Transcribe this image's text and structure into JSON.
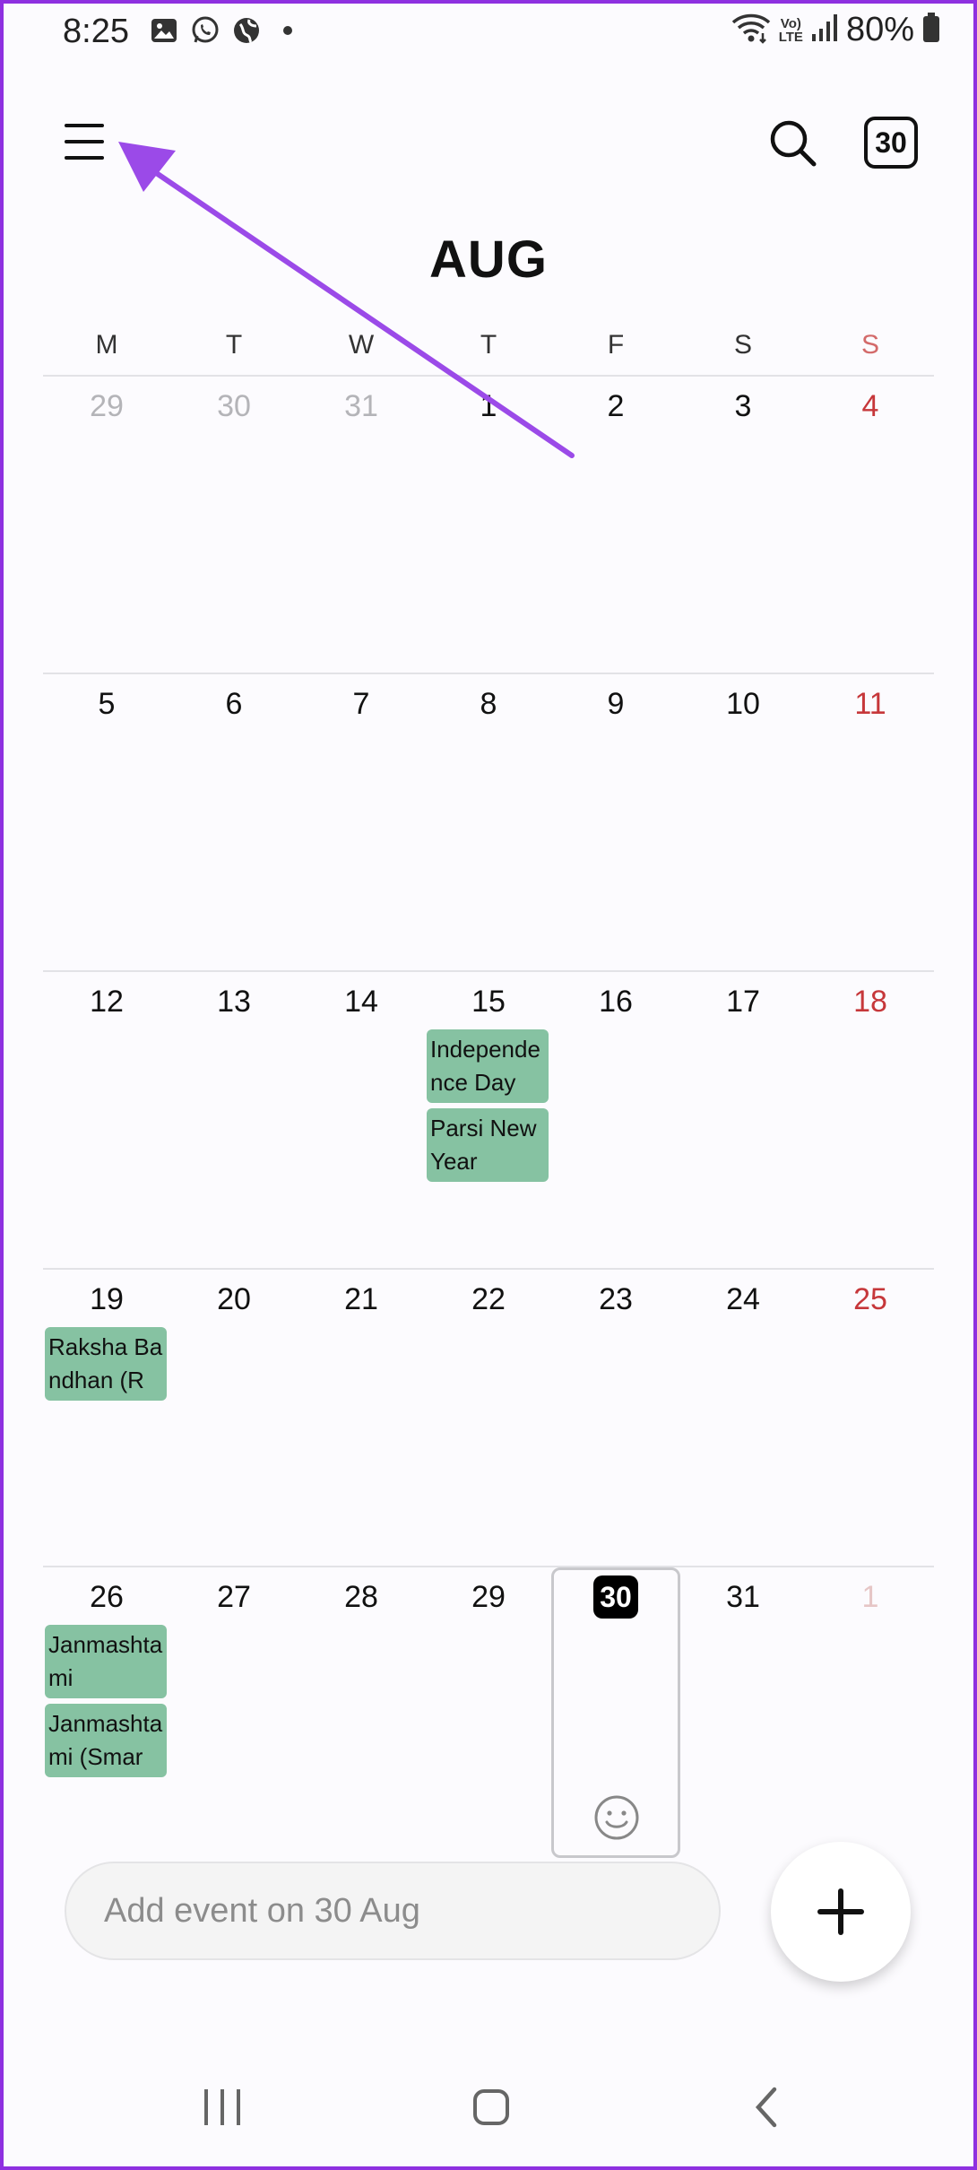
{
  "status_bar": {
    "time": "8:25",
    "battery": "80%",
    "volte_top": "Vo)",
    "volte_bottom": "LTE"
  },
  "header": {
    "month": "AUG",
    "today_button": "30"
  },
  "weekdays": [
    "M",
    "T",
    "W",
    "T",
    "F",
    "S",
    "S"
  ],
  "weeks": [
    {
      "days": [
        "29",
        "30",
        "31",
        "1",
        "2",
        "3",
        "4"
      ]
    },
    {
      "days": [
        "5",
        "6",
        "7",
        "8",
        "9",
        "10",
        "11"
      ]
    },
    {
      "days": [
        "12",
        "13",
        "14",
        "15",
        "16",
        "17",
        "18"
      ]
    },
    {
      "days": [
        "19",
        "20",
        "21",
        "22",
        "23",
        "24",
        "25"
      ]
    },
    {
      "days": [
        "26",
        "27",
        "28",
        "29",
        "30",
        "31",
        "1"
      ]
    }
  ],
  "events": {
    "independence_day": "Independence Day",
    "parsi_new_year": "Parsi New Year",
    "raksha_bandhan": "Raksha Bandhan (R",
    "janmashtami": "Janmashtami",
    "janmashtami_smarta": "Janmashtami (Smar"
  },
  "today": "30",
  "add_event": {
    "placeholder": "Add event on 30 Aug"
  },
  "colors": {
    "event": "#86c2a2",
    "sunday": "#c6373a",
    "arrow": "#9b4ae8",
    "frame": "#8e30e0"
  }
}
